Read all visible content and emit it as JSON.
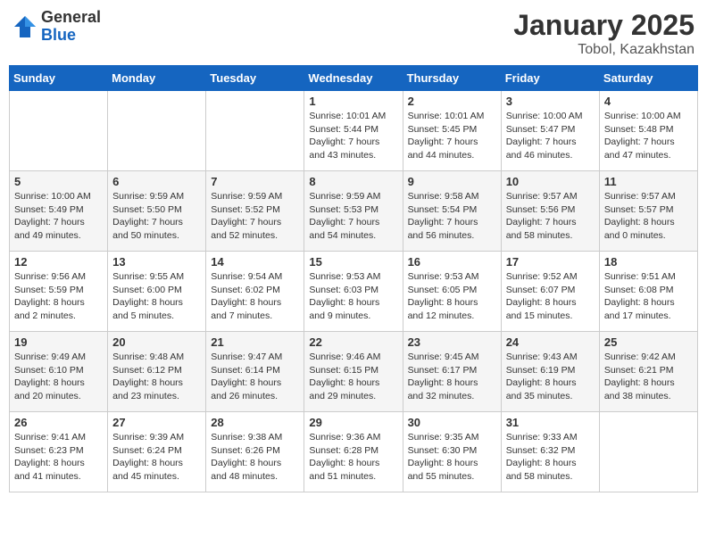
{
  "logo": {
    "general": "General",
    "blue": "Blue"
  },
  "title": "January 2025",
  "subtitle": "Tobol, Kazakhstan",
  "days_header": [
    "Sunday",
    "Monday",
    "Tuesday",
    "Wednesday",
    "Thursday",
    "Friday",
    "Saturday"
  ],
  "weeks": [
    [
      {
        "num": "",
        "info": ""
      },
      {
        "num": "",
        "info": ""
      },
      {
        "num": "",
        "info": ""
      },
      {
        "num": "1",
        "info": "Sunrise: 10:01 AM\nSunset: 5:44 PM\nDaylight: 7 hours and 43 minutes."
      },
      {
        "num": "2",
        "info": "Sunrise: 10:01 AM\nSunset: 5:45 PM\nDaylight: 7 hours and 44 minutes."
      },
      {
        "num": "3",
        "info": "Sunrise: 10:00 AM\nSunset: 5:47 PM\nDaylight: 7 hours and 46 minutes."
      },
      {
        "num": "4",
        "info": "Sunrise: 10:00 AM\nSunset: 5:48 PM\nDaylight: 7 hours and 47 minutes."
      }
    ],
    [
      {
        "num": "5",
        "info": "Sunrise: 10:00 AM\nSunset: 5:49 PM\nDaylight: 7 hours and 49 minutes."
      },
      {
        "num": "6",
        "info": "Sunrise: 9:59 AM\nSunset: 5:50 PM\nDaylight: 7 hours and 50 minutes."
      },
      {
        "num": "7",
        "info": "Sunrise: 9:59 AM\nSunset: 5:52 PM\nDaylight: 7 hours and 52 minutes."
      },
      {
        "num": "8",
        "info": "Sunrise: 9:59 AM\nSunset: 5:53 PM\nDaylight: 7 hours and 54 minutes."
      },
      {
        "num": "9",
        "info": "Sunrise: 9:58 AM\nSunset: 5:54 PM\nDaylight: 7 hours and 56 minutes."
      },
      {
        "num": "10",
        "info": "Sunrise: 9:57 AM\nSunset: 5:56 PM\nDaylight: 7 hours and 58 minutes."
      },
      {
        "num": "11",
        "info": "Sunrise: 9:57 AM\nSunset: 5:57 PM\nDaylight: 8 hours and 0 minutes."
      }
    ],
    [
      {
        "num": "12",
        "info": "Sunrise: 9:56 AM\nSunset: 5:59 PM\nDaylight: 8 hours and 2 minutes."
      },
      {
        "num": "13",
        "info": "Sunrise: 9:55 AM\nSunset: 6:00 PM\nDaylight: 8 hours and 5 minutes."
      },
      {
        "num": "14",
        "info": "Sunrise: 9:54 AM\nSunset: 6:02 PM\nDaylight: 8 hours and 7 minutes."
      },
      {
        "num": "15",
        "info": "Sunrise: 9:53 AM\nSunset: 6:03 PM\nDaylight: 8 hours and 9 minutes."
      },
      {
        "num": "16",
        "info": "Sunrise: 9:53 AM\nSunset: 6:05 PM\nDaylight: 8 hours and 12 minutes."
      },
      {
        "num": "17",
        "info": "Sunrise: 9:52 AM\nSunset: 6:07 PM\nDaylight: 8 hours and 15 minutes."
      },
      {
        "num": "18",
        "info": "Sunrise: 9:51 AM\nSunset: 6:08 PM\nDaylight: 8 hours and 17 minutes."
      }
    ],
    [
      {
        "num": "19",
        "info": "Sunrise: 9:49 AM\nSunset: 6:10 PM\nDaylight: 8 hours and 20 minutes."
      },
      {
        "num": "20",
        "info": "Sunrise: 9:48 AM\nSunset: 6:12 PM\nDaylight: 8 hours and 23 minutes."
      },
      {
        "num": "21",
        "info": "Sunrise: 9:47 AM\nSunset: 6:14 PM\nDaylight: 8 hours and 26 minutes."
      },
      {
        "num": "22",
        "info": "Sunrise: 9:46 AM\nSunset: 6:15 PM\nDaylight: 8 hours and 29 minutes."
      },
      {
        "num": "23",
        "info": "Sunrise: 9:45 AM\nSunset: 6:17 PM\nDaylight: 8 hours and 32 minutes."
      },
      {
        "num": "24",
        "info": "Sunrise: 9:43 AM\nSunset: 6:19 PM\nDaylight: 8 hours and 35 minutes."
      },
      {
        "num": "25",
        "info": "Sunrise: 9:42 AM\nSunset: 6:21 PM\nDaylight: 8 hours and 38 minutes."
      }
    ],
    [
      {
        "num": "26",
        "info": "Sunrise: 9:41 AM\nSunset: 6:23 PM\nDaylight: 8 hours and 41 minutes."
      },
      {
        "num": "27",
        "info": "Sunrise: 9:39 AM\nSunset: 6:24 PM\nDaylight: 8 hours and 45 minutes."
      },
      {
        "num": "28",
        "info": "Sunrise: 9:38 AM\nSunset: 6:26 PM\nDaylight: 8 hours and 48 minutes."
      },
      {
        "num": "29",
        "info": "Sunrise: 9:36 AM\nSunset: 6:28 PM\nDaylight: 8 hours and 51 minutes."
      },
      {
        "num": "30",
        "info": "Sunrise: 9:35 AM\nSunset: 6:30 PM\nDaylight: 8 hours and 55 minutes."
      },
      {
        "num": "31",
        "info": "Sunrise: 9:33 AM\nSunset: 6:32 PM\nDaylight: 8 hours and 58 minutes."
      },
      {
        "num": "",
        "info": ""
      }
    ]
  ]
}
